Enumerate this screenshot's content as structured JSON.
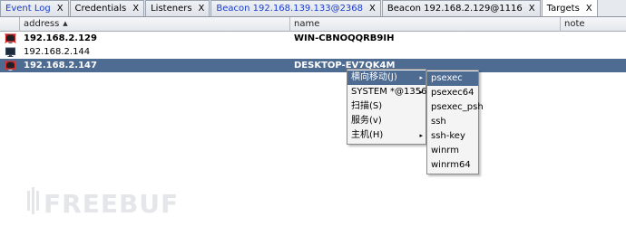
{
  "tabs": [
    {
      "label": "Event Log",
      "close": "X",
      "blue": true,
      "active": false
    },
    {
      "label": "Credentials",
      "close": "X",
      "blue": false,
      "active": false
    },
    {
      "label": "Listeners",
      "close": "X",
      "blue": false,
      "active": false
    },
    {
      "label": "Beacon 192.168.139.133@2368",
      "close": "X",
      "blue": true,
      "active": false
    },
    {
      "label": "Beacon 192.168.2.129@1116",
      "close": "X",
      "blue": false,
      "active": false
    },
    {
      "label": "Targets",
      "close": "X",
      "blue": false,
      "active": true
    }
  ],
  "table": {
    "columns": [
      "address",
      "name",
      "note"
    ],
    "sort_indicator": "▲",
    "rows": [
      {
        "address": "192.168.2.129",
        "name": "WIN-CBNOQQRB9IH",
        "icon": "compromised-windows-host-icon",
        "bold": true,
        "selected": false
      },
      {
        "address": "192.168.2.144",
        "name": "",
        "icon": "windows-host-icon",
        "bold": false,
        "selected": false
      },
      {
        "address": "192.168.2.147",
        "name": "DESKTOP-EV7QK4M",
        "icon": "compromised-windows-host-icon",
        "bold": true,
        "selected": true
      }
    ]
  },
  "context_menu": {
    "items": [
      {
        "label": "横向移动(J)",
        "submenu": true,
        "highlighted": true
      },
      {
        "label": "SYSTEM *@1356",
        "submenu": true,
        "highlighted": false
      },
      {
        "label": "扫描(S)",
        "submenu": false,
        "highlighted": false
      },
      {
        "label": "服务(v)",
        "submenu": false,
        "highlighted": false
      },
      {
        "label": "主机(H)",
        "submenu": true,
        "highlighted": false
      }
    ],
    "submenu": [
      "psexec",
      "psexec64",
      "psexec_psh",
      "ssh",
      "ssh-key",
      "winrm",
      "winrm64"
    ],
    "submenu_highlighted": "psexec"
  },
  "watermark": "FREEBUF",
  "colors": {
    "selection": "#4e6b91",
    "tab_blue_text": "#1a3ccc",
    "compromised_icon_red": "#cc2020"
  }
}
